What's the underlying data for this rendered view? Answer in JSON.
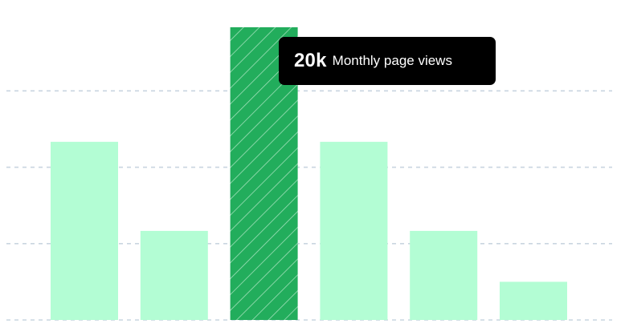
{
  "chart_data": {
    "type": "bar",
    "values": [
      14,
      7,
      23,
      14,
      7,
      3
    ],
    "highlighted_index": 2,
    "ylim": [
      0,
      23
    ],
    "gridlines": [
      6,
      12,
      18
    ],
    "grid": true,
    "tooltip": {
      "value": "20k",
      "label": "Monthly page views"
    },
    "colors": {
      "bar": "#b3fdd4",
      "highlight": "#22ad5c",
      "highlight_hatch": "#9fe0b9",
      "grid": "#c9d5e0"
    }
  }
}
